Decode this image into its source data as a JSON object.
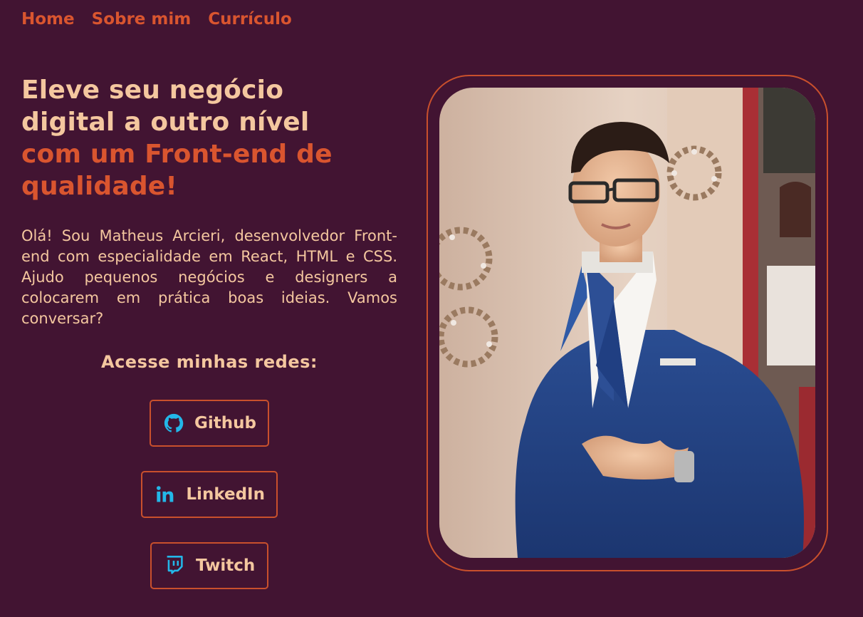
{
  "nav": {
    "items": [
      "Home",
      "Sobre mim",
      "Currículo"
    ]
  },
  "hero": {
    "title_line1": "Eleve seu negócio",
    "title_line2": "digital a outro nível",
    "title_line3": "com um Front-end de",
    "title_line4": "qualidade!",
    "intro": "Olá! Sou Matheus Arcieri, desenvolvedor Front-end com especialidade em React, HTML e CSS. Ajudo pequenos negócios e designers a colocarem em prática boas ideias. Vamos conversar?"
  },
  "social": {
    "title": "Acesse minhas redes:",
    "buttons": [
      {
        "label": "Github",
        "icon": "github-icon"
      },
      {
        "label": "LinkedIn",
        "icon": "linkedin-icon"
      },
      {
        "label": "Twitch",
        "icon": "twitch-icon"
      }
    ]
  },
  "photo": {
    "subject": "portrait-photo"
  },
  "colors": {
    "background": "#421432",
    "accent": "#d9552f",
    "light": "#f4c79f",
    "icon": "#23b7e8"
  }
}
